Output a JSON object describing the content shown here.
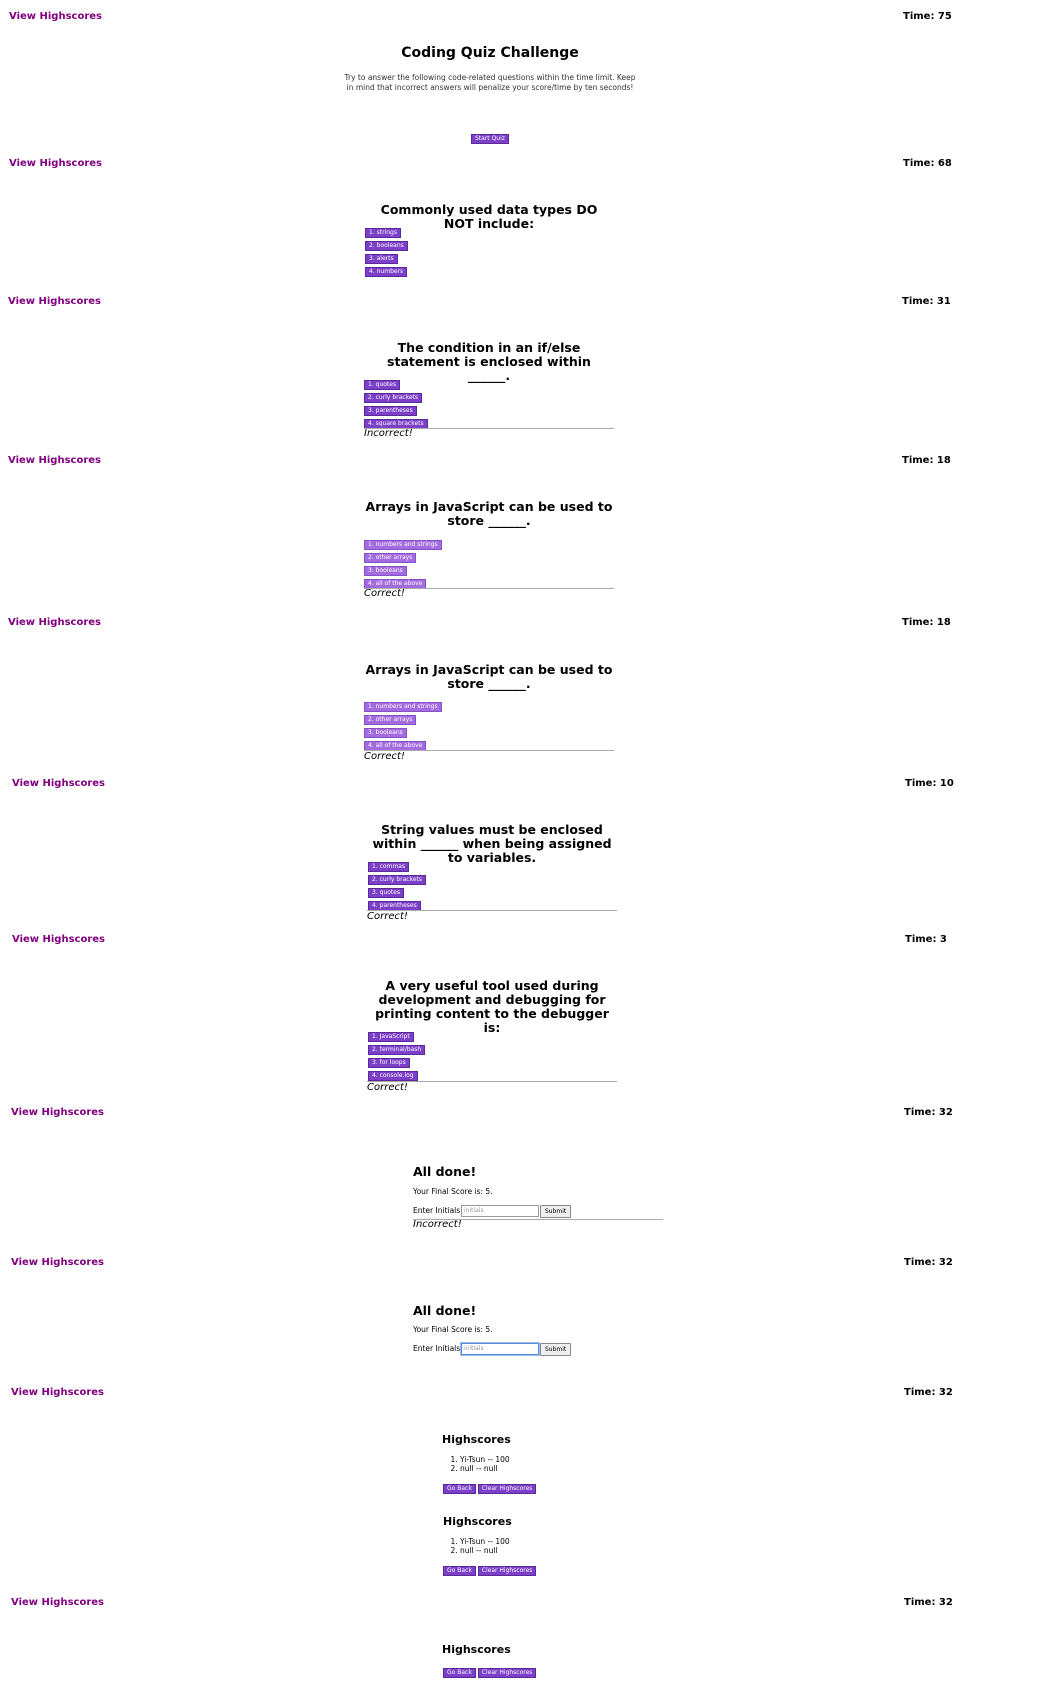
{
  "header": {
    "view_highscores": "View Highscores"
  },
  "timers": [
    "Time: 75",
    "Time: 68",
    "Time: 31",
    "Time: 18",
    "Time: 18",
    "Time: 10",
    "Time: 3",
    "Time: 32",
    "Time: 32",
    "Time: 32",
    "Time: 32"
  ],
  "intro": {
    "title": "Coding Quiz Challenge",
    "description": "Try to answer the following code-related questions within the time limit. Keep in mind that incorrect answers will penalize your score/time by ten seconds!",
    "start_button": "Start Quiz"
  },
  "questions": [
    {
      "text": "Commonly used data types DO NOT include:",
      "choices": [
        "1. strings",
        "2. booleans",
        "3. alerts",
        "4. numbers"
      ],
      "feedback": ""
    },
    {
      "text": "The condition in an if/else statement is enclosed within ______.",
      "choices": [
        "1. quotes",
        "2. curly brackets",
        "3. parentheses",
        "4. square brackets"
      ],
      "feedback": "Incorrect!"
    },
    {
      "text": "Arrays in JavaScript can be used to store ______.",
      "choices": [
        "1. numbers and strings",
        "2. other arrays",
        "3. booleans",
        "4. all of the above"
      ],
      "feedback": "Correct!"
    },
    {
      "text": "Arrays in JavaScript can be used to store ______.",
      "choices": [
        "1. numbers and strings",
        "2. other arrays",
        "3. booleans",
        "4. all of the above"
      ],
      "feedback": "Correct!"
    },
    {
      "text": "String values must be enclosed within ______ when being assigned to variables.",
      "choices": [
        "1. commas",
        "2. curly brackets",
        "3. quotes",
        "4. parentheses"
      ],
      "feedback": "Correct!"
    },
    {
      "text": "A very useful tool used during development and debugging for printing content to the debugger is:",
      "choices": [
        "1. JavaScript",
        "2. terminal/bash",
        "3. for loops",
        "4. console.log"
      ],
      "feedback": "Correct!"
    }
  ],
  "done": {
    "title": "All done!",
    "score_text": "Your Final Score is: 5.",
    "initials_label": "Enter Initials",
    "initials_placeholder": "initials",
    "submit": "Submit",
    "feedback": "Incorrect!"
  },
  "highscores": {
    "title": "Highscores",
    "entries": [
      "Yi-Tsun -- 100",
      "null -- null"
    ],
    "go_back": "Go Back",
    "clear": "Clear Highscores"
  }
}
